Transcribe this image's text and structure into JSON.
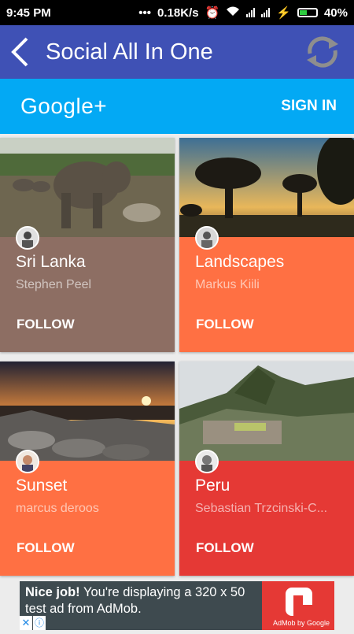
{
  "status_bar": {
    "time": "9:45 PM",
    "network_speed": "0.18K/s",
    "battery": "40%"
  },
  "app_bar": {
    "title": "Social All In One"
  },
  "google_bar": {
    "logo": "Google+",
    "sign_in": "SIGN IN"
  },
  "cards": [
    {
      "title": "Sri Lanka",
      "author": "Stephen Peel",
      "follow": "FOLLOW",
      "panel_color": "#8d6e63"
    },
    {
      "title": "Landscapes",
      "author": "Markus Kiili",
      "follow": "FOLLOW",
      "panel_color": "#ff7043"
    },
    {
      "title": "Sunset",
      "author": "marcus deroos",
      "follow": "FOLLOW",
      "panel_color": "#ff7043"
    },
    {
      "title": "Peru",
      "author": "Sebastian Trzcinski-C...",
      "follow": "FOLLOW",
      "panel_color": "#e53935"
    }
  ],
  "ad": {
    "headline": "Nice job!",
    "body": "You're displaying a 320 x 50 test ad from AdMob.",
    "brand": "AdMob by Google"
  },
  "colors": {
    "app_bar": "#3f51b5",
    "google_bar": "#03a9f4"
  }
}
